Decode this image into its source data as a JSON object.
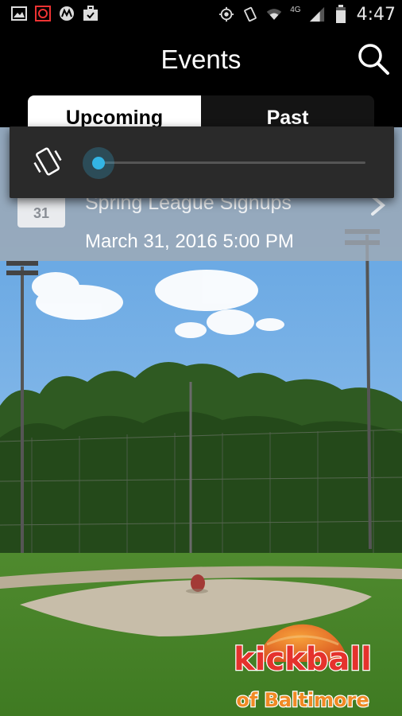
{
  "status_bar": {
    "time": "4:47",
    "network": "4G",
    "icons": [
      "image-icon",
      "app-notification-icon",
      "motorola-icon",
      "briefcase-icon",
      "location-icon",
      "vibrate-icon",
      "wifi-icon",
      "signal-icon",
      "battery-icon"
    ]
  },
  "header": {
    "title": "Events",
    "search_icon": "search-icon"
  },
  "tabs": [
    {
      "label": "Upcoming",
      "active": true
    },
    {
      "label": "Past",
      "active": false
    }
  ],
  "volume_dialog": {
    "mode_icon": "vibrate-icon",
    "level": 0
  },
  "events": [
    {
      "day": "31",
      "title": "Spring League Signups",
      "date": "March 31, 2016 5:00 PM"
    }
  ],
  "logo": {
    "line1": "kickball",
    "line2": "of Baltimore"
  },
  "colors": {
    "accent": "#33b5e5",
    "logo_red": "#e5322d",
    "logo_orange": "#f08a24"
  }
}
